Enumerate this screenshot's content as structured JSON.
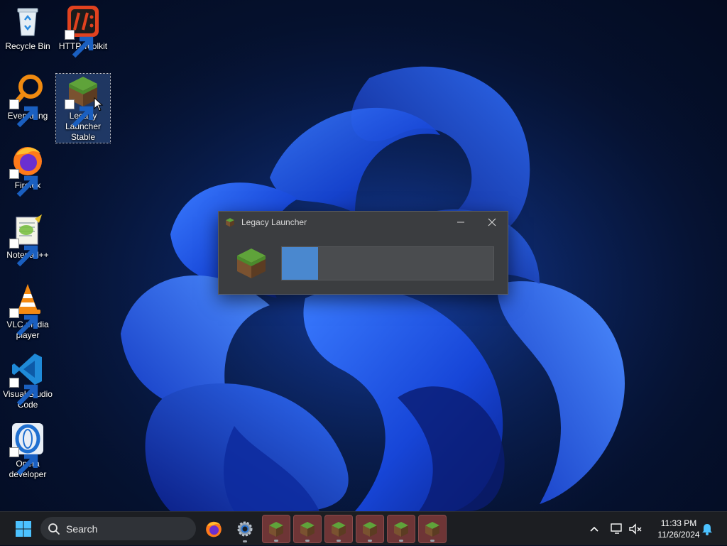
{
  "desktop": {
    "icons": [
      {
        "label": "Recycle Bin",
        "icon": "recycle-bin-icon"
      },
      {
        "label": "HTTP Toolkit",
        "icon": "http-toolkit-icon"
      },
      {
        "label": "Everything",
        "icon": "everything-search-icon"
      },
      {
        "label": "Legacy Launcher Stable",
        "icon": "minecraft-grass-block-icon",
        "selected": true
      },
      {
        "label": "Firefox",
        "icon": "firefox-icon"
      },
      {
        "label": "Notepad++",
        "icon": "notepad-plus-plus-icon"
      },
      {
        "label": "VLC media player",
        "icon": "vlc-cone-icon"
      },
      {
        "label": "Visual Studio Code",
        "icon": "vscode-icon"
      },
      {
        "label": "Opera developer",
        "icon": "opera-developer-icon"
      }
    ]
  },
  "launcher_window": {
    "title": "Legacy Launcher",
    "minimize_label": "—",
    "close_label": "✕",
    "progress_fraction": 0.17,
    "progress_color": "#4a88cf"
  },
  "taskbar": {
    "search_label": "Search",
    "apps": [
      {
        "name": "firefox-icon"
      },
      {
        "name": "settings-gear-icon"
      },
      {
        "name": "legacy-launcher-window-1"
      },
      {
        "name": "legacy-launcher-window-2"
      },
      {
        "name": "legacy-launcher-window-3"
      },
      {
        "name": "legacy-launcher-window-4"
      },
      {
        "name": "legacy-launcher-window-5"
      },
      {
        "name": "legacy-launcher-window-6"
      }
    ],
    "clock": {
      "time": "11:33 PM",
      "date": "11/26/2024"
    }
  },
  "colors": {
    "accent": "#4a88cf",
    "taskbar": "#1c1e22",
    "active_app": "#6e3536"
  }
}
